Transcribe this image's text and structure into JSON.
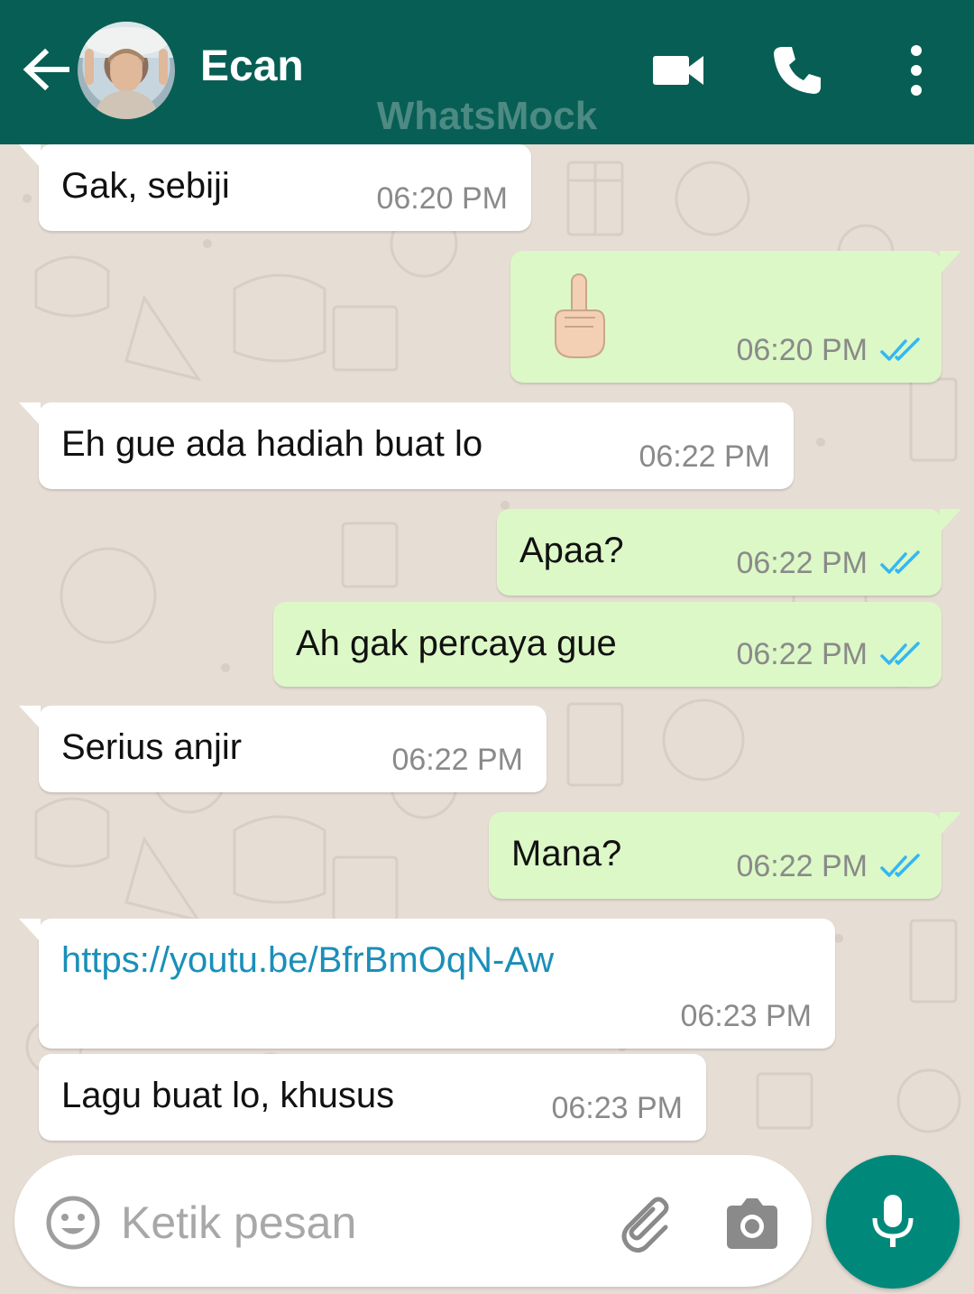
{
  "header": {
    "contact_name": "Ecan",
    "watermark": "WhatsMock"
  },
  "messages": [
    {
      "direction": "in",
      "text": "Gak, sebiji",
      "time": "06:20 PM"
    },
    {
      "direction": "out",
      "emoji": "middle-finger-emoji",
      "time": "06:20 PM",
      "read": true
    },
    {
      "direction": "in",
      "text": "Eh gue ada hadiah buat lo",
      "time": "06:22 PM"
    },
    {
      "direction": "out",
      "text": "Apaa?",
      "time": "06:22 PM",
      "read": true
    },
    {
      "direction": "out",
      "text": "Ah gak percaya gue",
      "time": "06:22 PM",
      "read": true
    },
    {
      "direction": "in",
      "text": "Serius anjir",
      "time": "06:22 PM"
    },
    {
      "direction": "out",
      "text": "Mana?",
      "time": "06:22 PM",
      "read": true
    },
    {
      "direction": "in",
      "text": "https://youtu.be/BfrBmOqN-Aw",
      "time": "06:23 PM",
      "is_link": true
    },
    {
      "direction": "in",
      "text": "Lagu buat lo, khusus",
      "time": "06:23 PM"
    }
  ],
  "input": {
    "placeholder": "Ketik pesan"
  },
  "colors": {
    "header": "#075e54",
    "outgoing_bubble": "#dcf8c6",
    "incoming_bubble": "#ffffff",
    "read_ticks": "#34b7f1",
    "mic_button": "#00897b",
    "link": "#1a8fb8"
  },
  "icons": [
    "back-arrow-icon",
    "video-call-icon",
    "voice-call-icon",
    "more-options-icon",
    "emoji-icon",
    "attach-icon",
    "camera-icon",
    "mic-icon"
  ]
}
